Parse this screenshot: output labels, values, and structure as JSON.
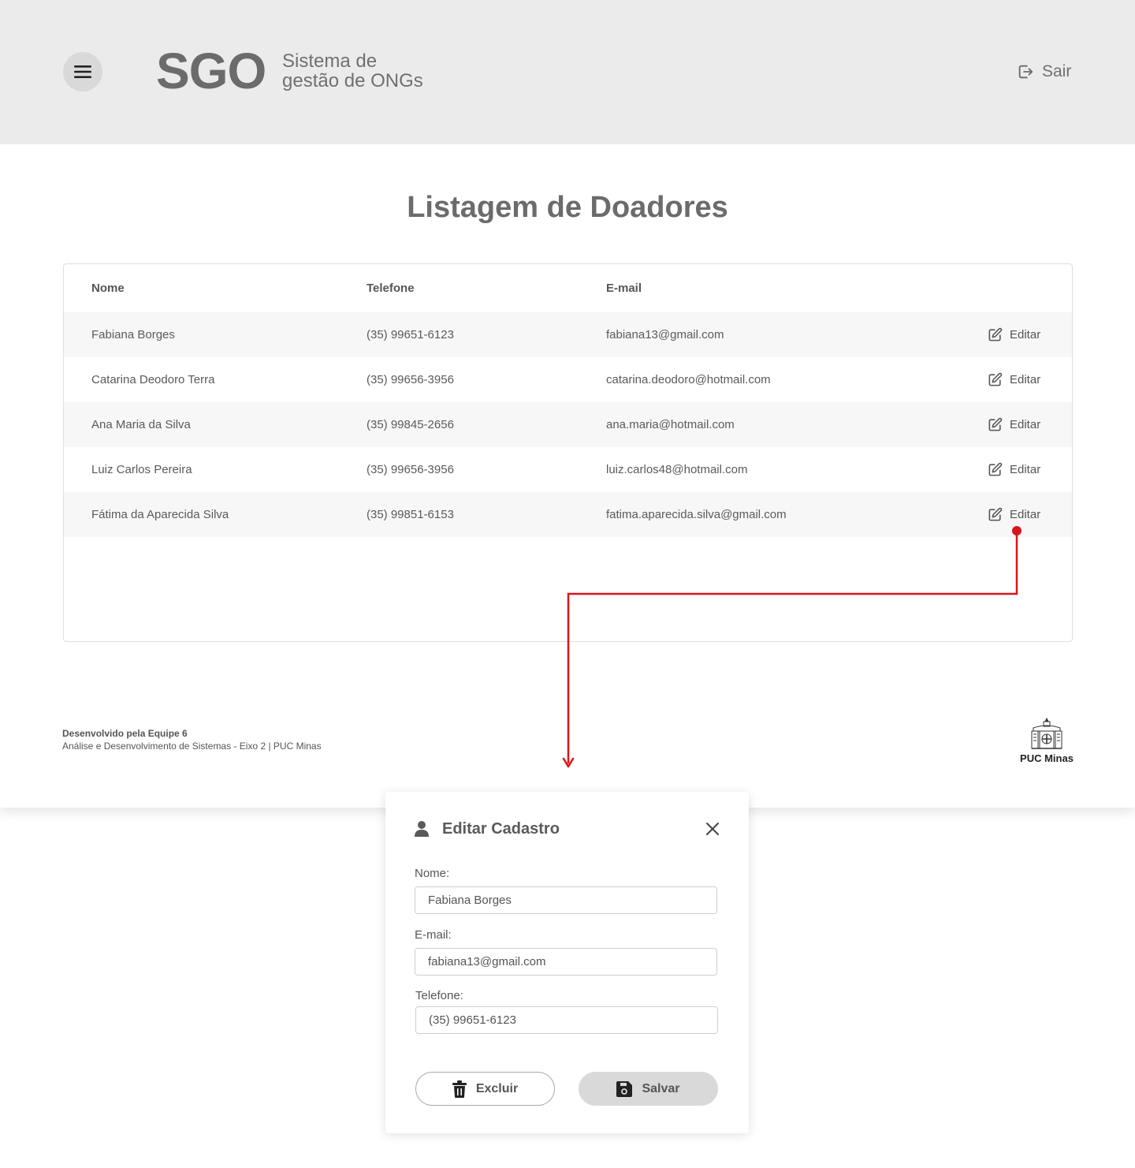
{
  "header": {
    "logo": "SGO",
    "subtitle_line1": "Sistema de",
    "subtitle_line2": "gestão de ONGs",
    "logout_label": "Sair"
  },
  "main": {
    "title": "Listagem de Doadores",
    "columns": [
      "Nome",
      "Telefone",
      "E-mail"
    ],
    "edit_label": "Editar",
    "rows": [
      {
        "name": "Fabiana Borges",
        "phone": "(35) 99651-6123",
        "email": "fabiana13@gmail.com"
      },
      {
        "name": "Catarina Deodoro Terra",
        "phone": "(35) 99656-3956",
        "email": "catarina.deodoro@hotmail.com"
      },
      {
        "name": "Ana Maria da Silva",
        "phone": "(35) 99845-2656",
        "email": "ana.maria@hotmail.com"
      },
      {
        "name": "Luiz Carlos Pereira",
        "phone": "(35) 99656-3956",
        "email": "luiz.carlos48@hotmail.com"
      },
      {
        "name": "Fátima da Aparecida Silva",
        "phone": "(35) 99851-6153",
        "email": "fatima.aparecida.silva@gmail.com"
      }
    ]
  },
  "footer": {
    "credit": "Desenvolvido pela Equipe 6",
    "course": "Análise e Desenvolvimento de Sistemas - Eixo 2 | PUC Minas",
    "brand": "PUC Minas"
  },
  "modal": {
    "title": "Editar Cadastro",
    "name_label": "Nome:",
    "name_value": "Fabiana Borges",
    "email_label": "E-mail:",
    "email_value": "fabiana13@gmail.com",
    "phone_label": "Telefone:",
    "phone_value": "(35) 99651-6123",
    "delete_label": "Excluir",
    "save_label": "Salvar"
  },
  "colors": {
    "header_bg": "#ebebeb",
    "stripe": "#f7f7f7",
    "annotation": "#d9151b",
    "save_button": "#d9d9d9"
  },
  "icons": [
    "menu-icon",
    "logout-icon",
    "edit-icon",
    "user-icon",
    "close-icon",
    "trash-icon",
    "save-icon",
    "puc-crest-icon"
  ]
}
